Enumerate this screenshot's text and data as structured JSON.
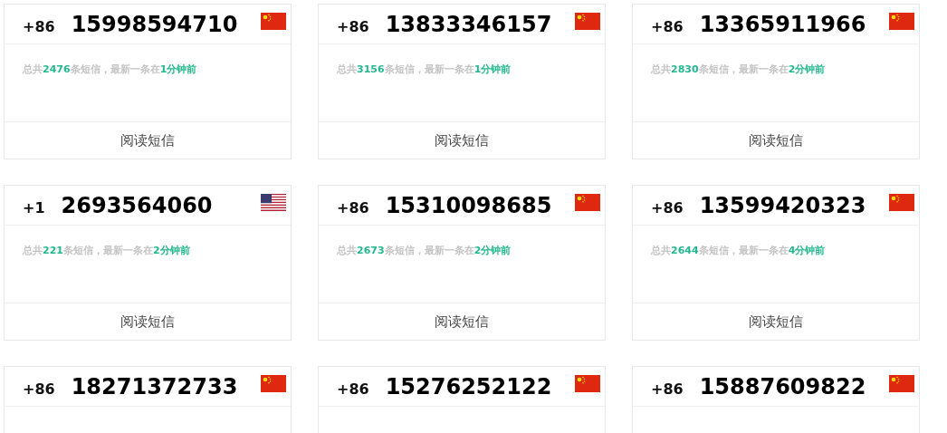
{
  "cards": [
    {
      "country_code": "+86",
      "number": "15998594710",
      "kind": "cn",
      "summary": "总共**2476**条短信，最新一条在**1分钟前**",
      "button": "阅读短信"
    },
    {
      "country_code": "+86",
      "number": "13833346157",
      "kind": "cn",
      "summary": "总共**3156**条短信，最新一条在**1分钟前**",
      "button": "阅读短信"
    },
    {
      "country_code": "+86",
      "number": "13365911966",
      "kind": "cn",
      "summary": "总共**2830**条短信，最新一条在**2分钟前**",
      "button": "阅读短信"
    },
    {
      "country_code": "+1",
      "number": "2693564060",
      "kind": "us",
      "summary": "总共**221**条短信，最新一条在**2分钟前**",
      "button": "阅读短信"
    },
    {
      "country_code": "+86",
      "number": "15310098685",
      "kind": "cn",
      "summary": "总共**2673**条短信，最新一条在**2分钟前**",
      "button": "阅读短信"
    },
    {
      "country_code": "+86",
      "number": "13599420323",
      "kind": "cn",
      "summary": "总共**2644**条短信，最新一条在**4分钟前**",
      "button": "阅读短信"
    },
    {
      "country_code": "+86",
      "number": "18271372733",
      "kind": "cn"
    },
    {
      "country_code": "+86",
      "number": "15276252122",
      "kind": "cn"
    },
    {
      "country_code": "+86",
      "number": "15887609822",
      "kind": "cn"
    }
  ]
}
